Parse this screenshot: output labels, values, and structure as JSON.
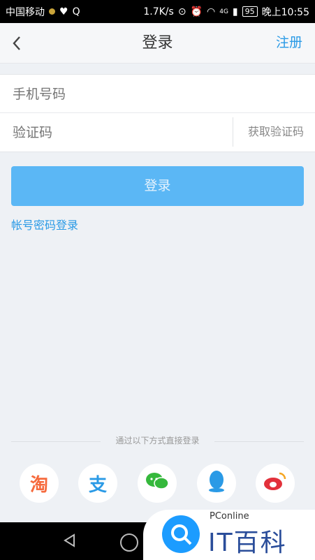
{
  "status_bar": {
    "carrier": "中国移动",
    "speed": "1.7K/s",
    "signal_tag": "4G",
    "battery": "95",
    "time": "晚上10:55"
  },
  "header": {
    "title": "登录",
    "register": "注册"
  },
  "form": {
    "phone_placeholder": "手机号码",
    "code_placeholder": "验证码",
    "get_code": "获取验证码"
  },
  "login_button": "登录",
  "password_login": "帐号密码登录",
  "other_login": "通过以下方式直接登录",
  "social": [
    {
      "label": "淘",
      "icon": "taobao-icon",
      "color": "#f66a3d"
    },
    {
      "label": "支",
      "icon": "alipay-icon",
      "color": "#2a9ae6"
    },
    {
      "label": "微",
      "icon": "wechat-icon",
      "color": "#35b83c"
    },
    {
      "label": "Q",
      "icon": "qq-icon",
      "color": "#2a9ae6"
    },
    {
      "label": "微博",
      "icon": "weibo-icon",
      "color": "#e2313b"
    }
  ],
  "watermark": {
    "small": "PConline",
    "big": "IT百科"
  }
}
